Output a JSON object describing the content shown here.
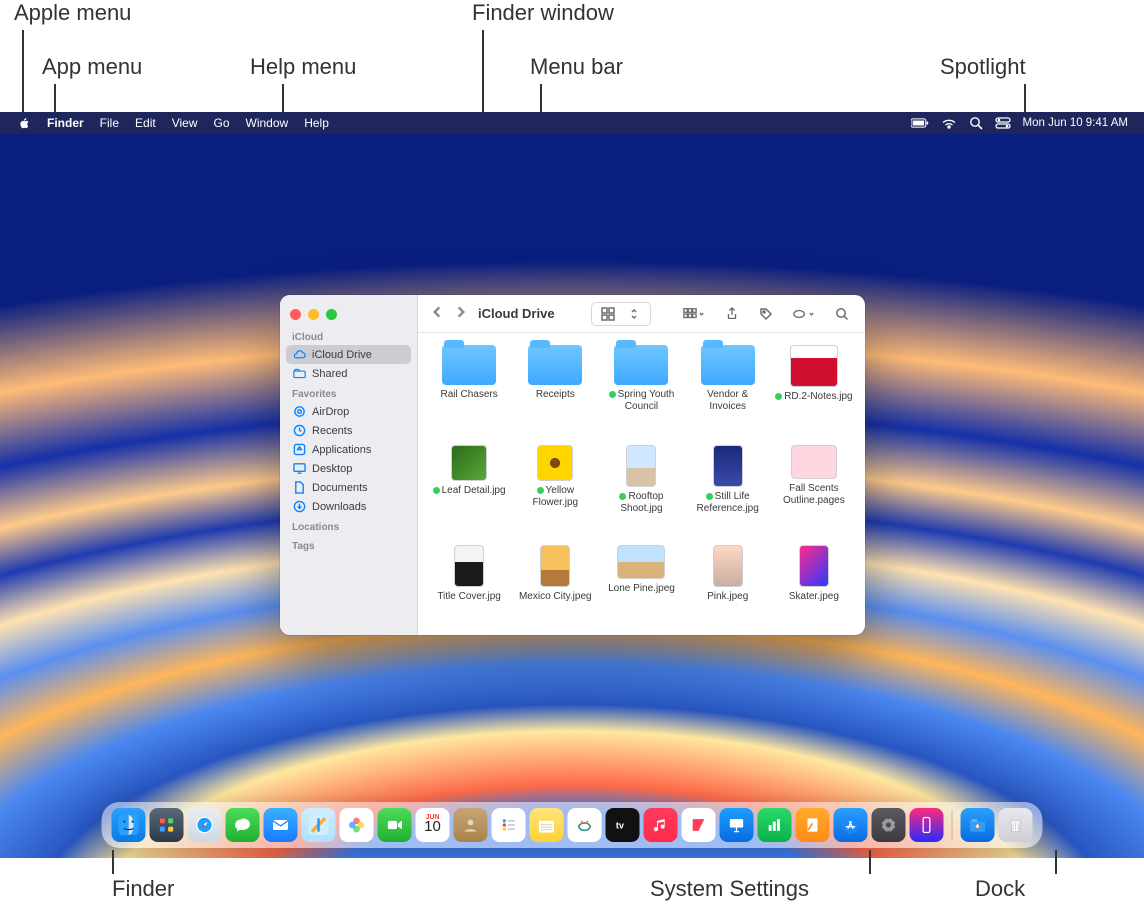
{
  "callouts": {
    "apple_menu": "Apple menu",
    "app_menu": "App menu",
    "help_menu": "Help menu",
    "finder_window": "Finder window",
    "menu_bar": "Menu bar",
    "spotlight": "Spotlight",
    "finder": "Finder",
    "system_settings": "System Settings",
    "dock": "Dock"
  },
  "menubar": {
    "app": "Finder",
    "items": {
      "file": "File",
      "edit": "Edit",
      "view": "View",
      "go": "Go",
      "window": "Window",
      "help": "Help"
    },
    "clock": "Mon Jun 10  9:41 AM"
  },
  "finder": {
    "title": "iCloud Drive",
    "sidebar": {
      "section_icloud": "iCloud",
      "icloud_drive": "iCloud Drive",
      "shared": "Shared",
      "section_favorites": "Favorites",
      "airdrop": "AirDrop",
      "recents": "Recents",
      "applications": "Applications",
      "desktop": "Desktop",
      "documents": "Documents",
      "downloads": "Downloads",
      "section_locations": "Locations",
      "section_tags": "Tags"
    },
    "items": {
      "rail_chasers": "Rail Chasers",
      "receipts": "Receipts",
      "spring_youth": "Spring Youth Council",
      "vendor": "Vendor & Invoices",
      "rdnotes": "RD.2-Notes.jpg",
      "leaf": "Leaf Detail.jpg",
      "flower": "Yellow Flower.jpg",
      "rooftop": "Rooftop Shoot.jpg",
      "still": "Still Life Reference.jpg",
      "scent": "Fall Scents Outline.pages",
      "title_cover": "Title Cover.jpg",
      "mexico": "Mexico City.jpeg",
      "pine": "Lone Pine.jpeg",
      "pink": "Pink.jpeg",
      "skater": "Skater.jpeg"
    }
  },
  "dock": {
    "cal_month": "JUN",
    "cal_day": "10"
  }
}
